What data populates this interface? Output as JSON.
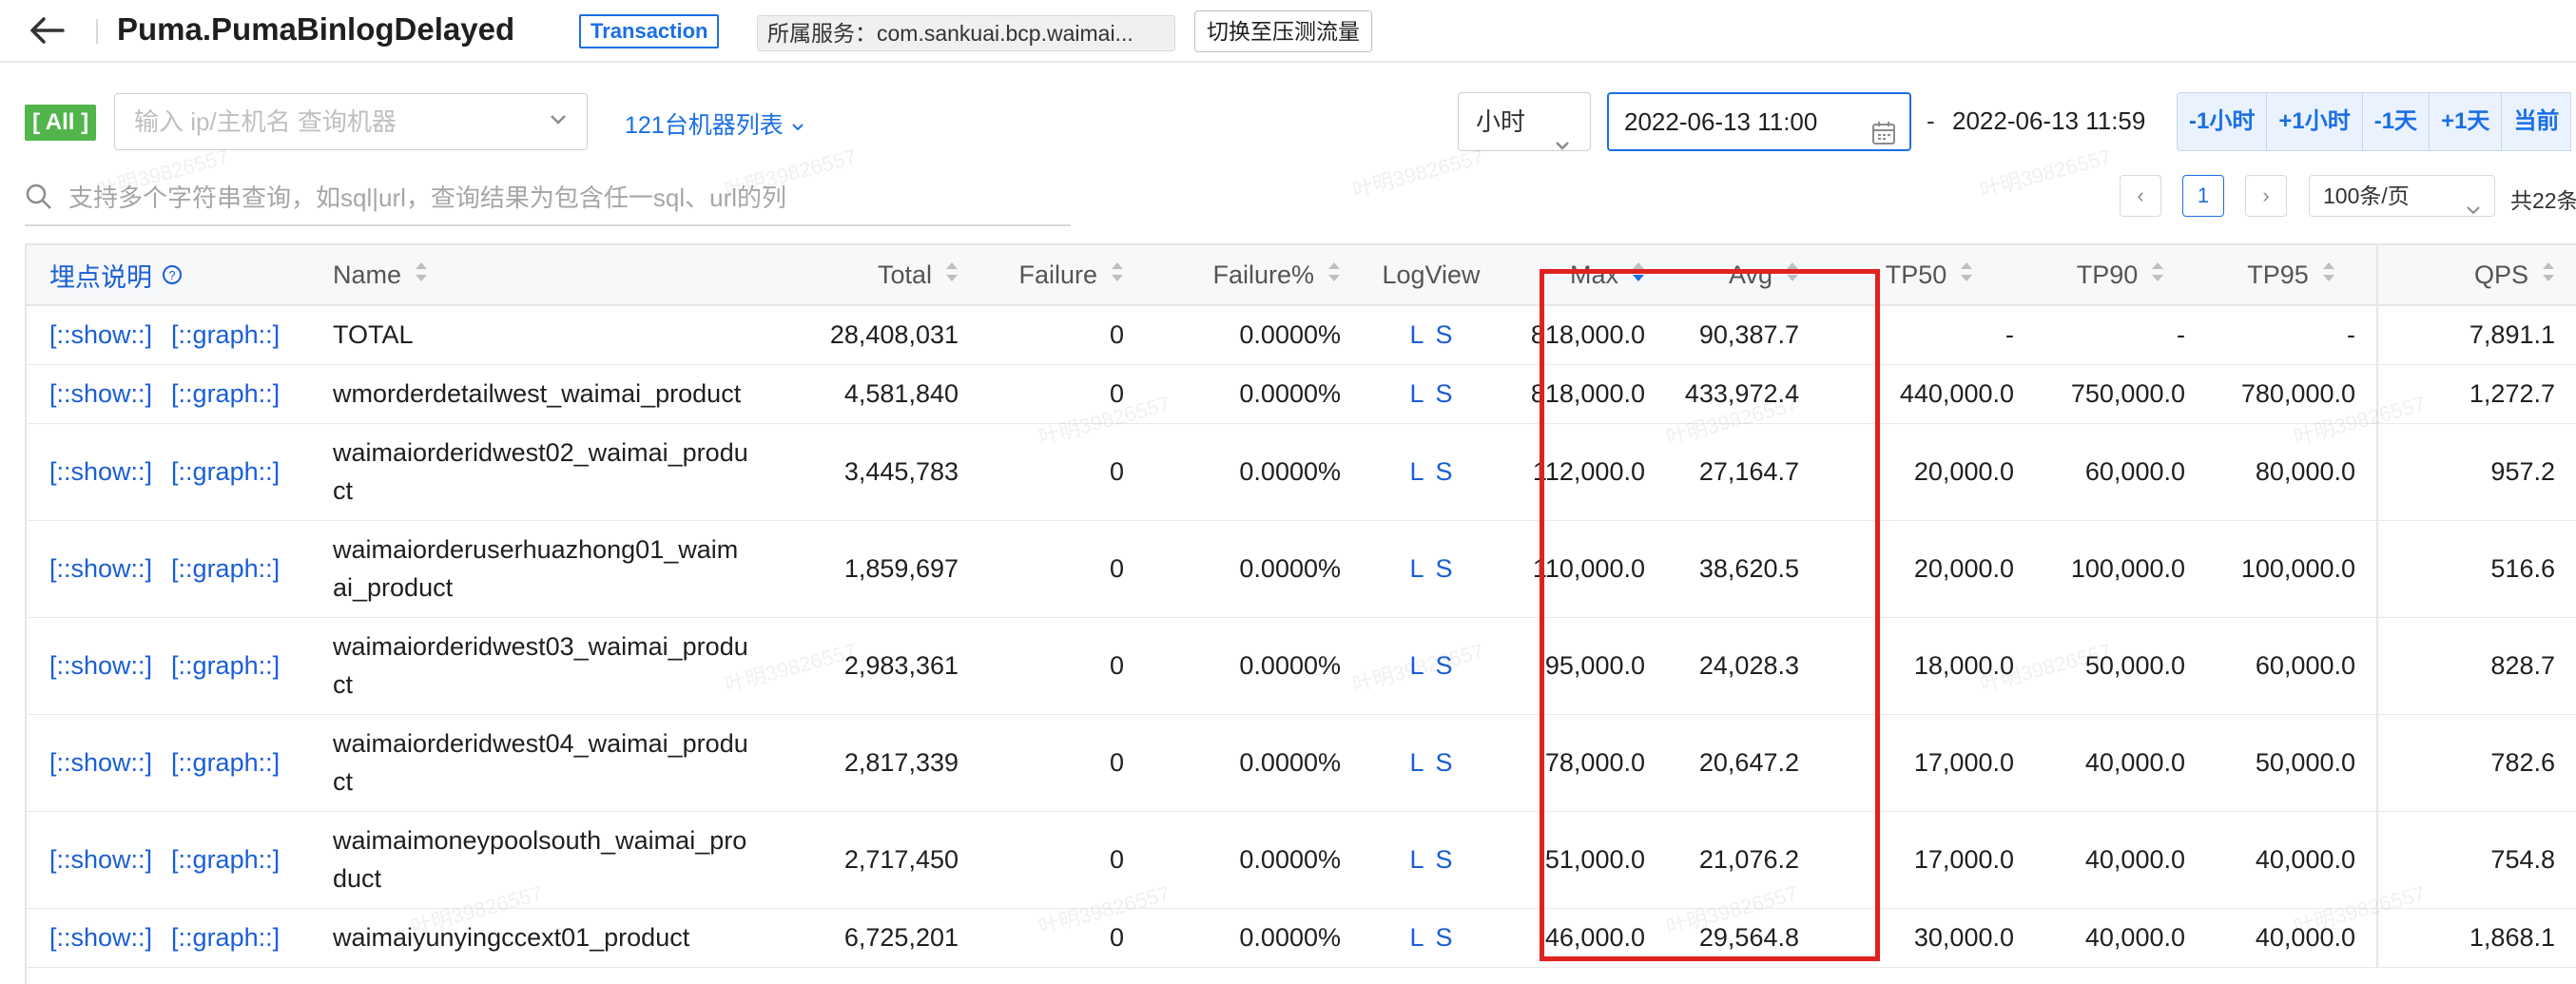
{
  "header": {
    "title": "Puma.PumaBinlogDelayed",
    "type_tag": "Transaction",
    "service": "所属服务：com.sankuai.bcp.waimai...",
    "switch_label": "切换至压测流量"
  },
  "filter": {
    "all_label": "[ All ]",
    "machine_placeholder": "输入 ip/主机名 查询机器",
    "machine_list": "121台机器列表",
    "unit": "小时",
    "date_start": "2022-06-13 11:00",
    "date_dash": "-",
    "date_end": "2022-06-13 11:59",
    "shift_buttons": [
      "-1小时",
      "+1小时",
      "-1天",
      "+1天",
      "当前"
    ],
    "query_placeholder": "支持多个字符串查询，如sql|url，查询结果为包含任一sql、url的列"
  },
  "pagination": {
    "prev": "‹",
    "current": "1",
    "next": "›",
    "page_size": "100条/页",
    "total": "共22条"
  },
  "table": {
    "headers": {
      "tracking": "埋点说明",
      "name": "Name",
      "total": "Total",
      "failure": "Failure",
      "failure_pct": "Failure%",
      "logview": "LogView",
      "max": "Max",
      "avg": "Avg",
      "tp50": "TP50",
      "tp90": "TP90",
      "tp95": "TP95",
      "qps": "QPS"
    },
    "show_label": "[::show::]",
    "graph_label": "[::graph::]",
    "logview_l": "L",
    "logview_s": "S",
    "rows": [
      {
        "name": "TOTAL",
        "total": "28,408,031",
        "failure": "0",
        "failure_pct": "0.0000%",
        "max": "818,000.0",
        "avg": "90,387.7",
        "tp50": "-",
        "tp90": "-",
        "tp95": "-",
        "qps": "7,891.1"
      },
      {
        "name": "wmorderdetailwest_waimai_product",
        "total": "4,581,840",
        "failure": "0",
        "failure_pct": "0.0000%",
        "max": "818,000.0",
        "avg": "433,972.4",
        "tp50": "440,000.0",
        "tp90": "750,000.0",
        "tp95": "780,000.0",
        "qps": "1,272.7"
      },
      {
        "name": "waimaiorderidwest02_waimai_product",
        "total": "3,445,783",
        "failure": "0",
        "failure_pct": "0.0000%",
        "max": "112,000.0",
        "avg": "27,164.7",
        "tp50": "20,000.0",
        "tp90": "60,000.0",
        "tp95": "80,000.0",
        "qps": "957.2"
      },
      {
        "name": "waimaiorderuserhuazhong01_waimai_product",
        "total": "1,859,697",
        "failure": "0",
        "failure_pct": "0.0000%",
        "max": "110,000.0",
        "avg": "38,620.5",
        "tp50": "20,000.0",
        "tp90": "100,000.0",
        "tp95": "100,000.0",
        "qps": "516.6"
      },
      {
        "name": "waimaiorderidwest03_waimai_product",
        "total": "2,983,361",
        "failure": "0",
        "failure_pct": "0.0000%",
        "max": "95,000.0",
        "avg": "24,028.3",
        "tp50": "18,000.0",
        "tp90": "50,000.0",
        "tp95": "60,000.0",
        "qps": "828.7"
      },
      {
        "name": "waimaiorderidwest04_waimai_product",
        "total": "2,817,339",
        "failure": "0",
        "failure_pct": "0.0000%",
        "max": "78,000.0",
        "avg": "20,647.2",
        "tp50": "17,000.0",
        "tp90": "40,000.0",
        "tp95": "50,000.0",
        "qps": "782.6"
      },
      {
        "name": "waimaimoneypoolsouth_waimai_product",
        "total": "2,717,450",
        "failure": "0",
        "failure_pct": "0.0000%",
        "max": "51,000.0",
        "avg": "21,076.2",
        "tp50": "17,000.0",
        "tp90": "40,000.0",
        "tp95": "40,000.0",
        "qps": "754.8"
      },
      {
        "name": "waimaiyunyingccext01_product",
        "total": "6,725,201",
        "failure": "0",
        "failure_pct": "0.0000%",
        "max": "46,000.0",
        "avg": "29,564.8",
        "tp50": "30,000.0",
        "tp90": "40,000.0",
        "tp95": "40,000.0",
        "qps": "1,868.1"
      }
    ]
  },
  "watermark_text": "叶明39826557",
  "colors": {
    "accent": "#1a6fe6",
    "link": "#1a5ed6",
    "all_tag": "#52b54b",
    "highlight": "#e0221f"
  }
}
